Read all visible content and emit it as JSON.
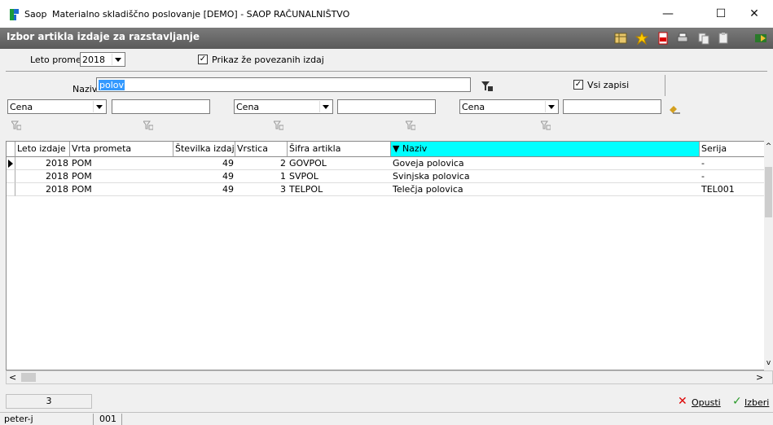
{
  "window": {
    "app_label": "Saop",
    "title": "Materialno skladiščno poslovanje [DEMO] - SAOP RAČUNALNIŠTVO",
    "minimize": "—",
    "maximize": "☐",
    "close": "✕"
  },
  "form": {
    "title": "Izbor artikla izdaje za razstavljanje"
  },
  "toolbar_icons": [
    "grid-icon",
    "star-icon",
    "pdf-icon",
    "print-icon",
    "copy-icon",
    "paste-icon",
    "export-icon"
  ],
  "filters": {
    "leto_label": "Leto prometa",
    "leto_value": "2018",
    "prikaz_label": "Prikaz že povezanih izdaj",
    "prikaz_checked": "✓",
    "naziv_label": "Naziv",
    "naziv_value": "polov",
    "vsi_label": "Vsi zapisi",
    "vsi_checked": "✓",
    "cena1": "Cena",
    "cena2": "Cena",
    "cena3": "Cena"
  },
  "grid": {
    "columns": [
      "Leto izdaje",
      "Vrta prometa",
      "Številka izdaje",
      "Vrstica",
      "Šifra artikla",
      "▼ Naziv",
      "Serija"
    ],
    "rows": [
      {
        "leto": "2018",
        "vrta": "POM",
        "stevilka": "49",
        "vrstica": "2",
        "sifra": "GOVPOL",
        "naziv": "Goveja polovica",
        "serija": "-"
      },
      {
        "leto": "2018",
        "vrta": "POM",
        "stevilka": "49",
        "vrstica": "1",
        "sifra": "SVPOL",
        "naziv": "Svinjska polovica",
        "serija": "-"
      },
      {
        "leto": "2018",
        "vrta": "POM",
        "stevilka": "49",
        "vrstica": "3",
        "sifra": "TELPOL",
        "naziv": "Telečja polovica",
        "serija": "TEL001"
      }
    ]
  },
  "footer": {
    "count": "3",
    "cancel_label": "Opusti",
    "select_label": "Izberi",
    "status_user": "peter-j",
    "status_code": "001"
  },
  "colors": {
    "sorted_header": "#00ffff",
    "header_strip": "#666666"
  }
}
